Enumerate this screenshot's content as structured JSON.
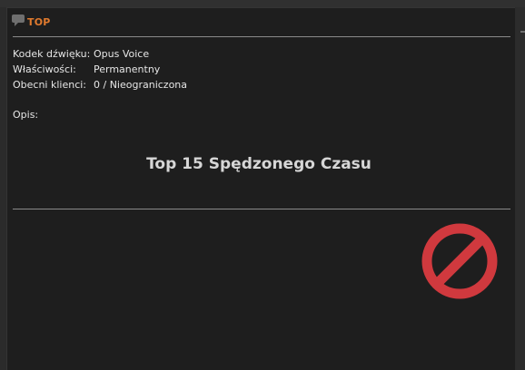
{
  "channel": {
    "name": "TOP"
  },
  "info": {
    "codec_label": "Kodek dźwięku:",
    "codec_value": "Opus Voice",
    "properties_label": "Właściwości:",
    "properties_value": "Permanentny",
    "clients_label": "Obecni klienci:",
    "clients_value": "0 / Nieograniczona"
  },
  "description": {
    "label": "Opis:",
    "title": "Top 15 Spędzonego Czasu"
  },
  "colors": {
    "panel_bg": "#1e1e1e",
    "channel_name": "#e07a2e",
    "no_sign": "#d0393e"
  },
  "icons": {
    "channel": "channel-bubble-icon",
    "no_entry": "no-entry-icon"
  }
}
